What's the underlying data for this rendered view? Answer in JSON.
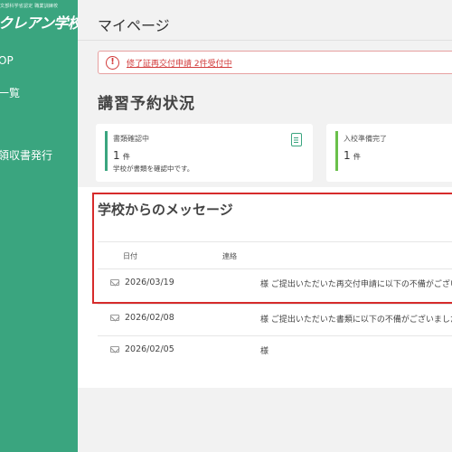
{
  "sidebar": {
    "brand_sub": "文部科学省認定 職業訓練校",
    "brand": "クレアン学校",
    "items": [
      {
        "label": "OP"
      },
      {
        "label": "一覧"
      },
      {
        "label": "領収書発行"
      }
    ]
  },
  "header": {
    "title": "マイページ"
  },
  "alert": {
    "icon": "info-circle-icon",
    "text": "修了証再交付申請 2件受付中",
    "color": "#d23b3b"
  },
  "reservations": {
    "title": "講習予約状況",
    "cards": [
      {
        "label": "書類確認中",
        "count": "1",
        "unit": "件",
        "sub": "学校が書類を確認中です。",
        "accent": "#3aa57f",
        "icon": "document-icon"
      },
      {
        "label": "入校準備完了",
        "count": "1",
        "unit": "件",
        "accent": "#6ac04b"
      }
    ]
  },
  "messages": {
    "title": "学校からのメッセージ",
    "columns": [
      "日付",
      "連絡"
    ],
    "rows": [
      {
        "date": "2026/03/19",
        "text": "様 ご提出いただいた再交付申請に以下の不備がござい"
      },
      {
        "date": "2026/02/08",
        "text": "様 ご提出いただいた書類に以下の不備がございました。"
      },
      {
        "date": "2026/02/05",
        "text": "様"
      }
    ]
  },
  "colors": {
    "sidebar": "#3aa57f",
    "highlight": "#d62b2b"
  }
}
